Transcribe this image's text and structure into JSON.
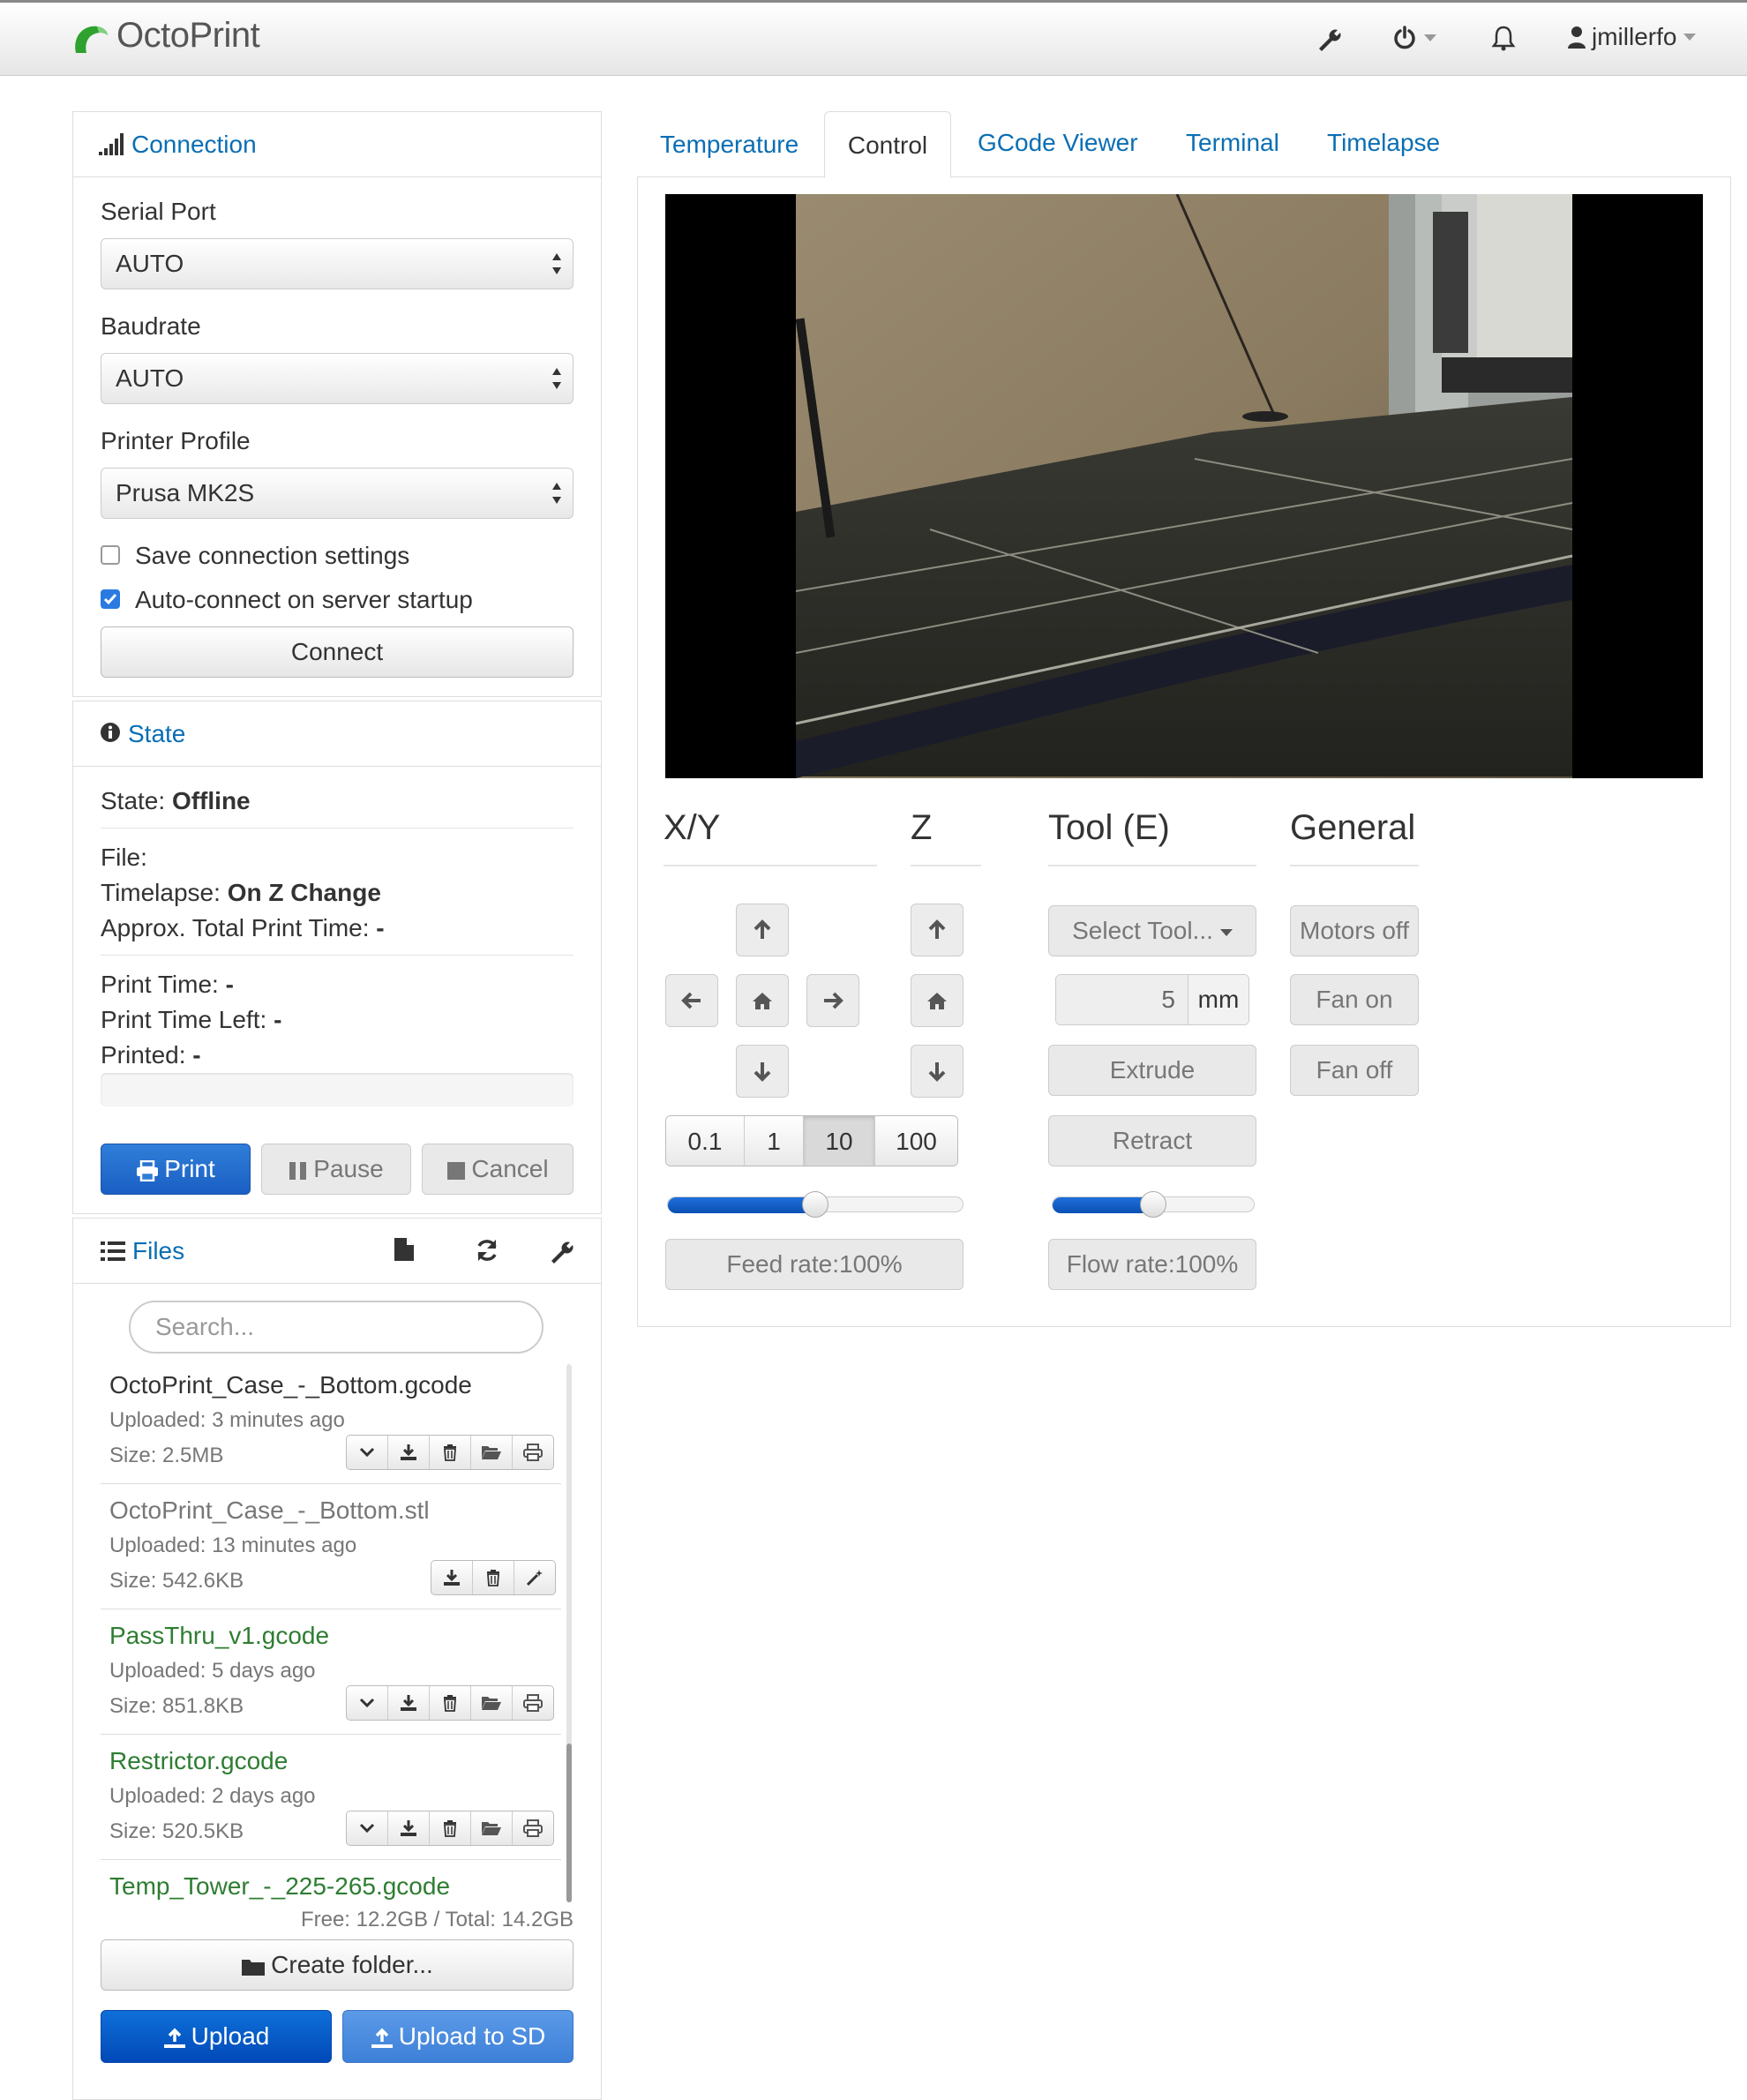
{
  "app": {
    "brand": "OctoPrint",
    "username": "jmillerfo"
  },
  "connection": {
    "title": "Connection",
    "serial_port_label": "Serial Port",
    "serial_port_value": "AUTO",
    "baudrate_label": "Baudrate",
    "baudrate_value": "AUTO",
    "profile_label": "Printer Profile",
    "profile_value": "Prusa MK2S",
    "save_label": "Save connection settings",
    "save_checked": false,
    "autoconnect_label": "Auto-connect on server startup",
    "autoconnect_checked": true,
    "connect_button": "Connect"
  },
  "state": {
    "title": "State",
    "state_label": "State:",
    "state_value": "Offline",
    "file_label": "File:",
    "timelapse_label": "Timelapse:",
    "timelapse_value": "On Z Change",
    "approx_label": "Approx. Total Print Time:",
    "approx_value": "-",
    "print_time_label": "Print Time:",
    "print_time_value": "-",
    "time_left_label": "Print Time Left:",
    "time_left_value": "-",
    "printed_label": "Printed:",
    "printed_value": "-",
    "progress": 0,
    "print_button": "Print",
    "pause_button": "Pause",
    "cancel_button": "Cancel"
  },
  "files": {
    "title": "Files",
    "search_placeholder": "Search...",
    "items": [
      {
        "name": "OctoPrint_Case_-_Bottom.gcode",
        "uploaded": "Uploaded: 3 minutes ago",
        "size": "Size: 2.5MB",
        "color": "#333333"
      },
      {
        "name": "OctoPrint_Case_-_Bottom.stl",
        "uploaded": "Uploaded: 13 minutes ago",
        "size": "Size: 542.6KB",
        "color": "#777777"
      },
      {
        "name": "PassThru_v1.gcode",
        "uploaded": "Uploaded: 5 days ago",
        "size": "Size: 851.8KB",
        "color": "#2e7d32"
      },
      {
        "name": "Restrictor.gcode",
        "uploaded": "Uploaded: 2 days ago",
        "size": "Size: 520.5KB",
        "color": "#2e7d32"
      },
      {
        "name": "Temp_Tower_-_225-265.gcode",
        "color": "#2e7d32"
      }
    ],
    "storage": "Free: 12.2GB / Total: 14.2GB",
    "create_folder_button": "Create folder...",
    "upload_button": "Upload",
    "upload_sd_button": "Upload to SD"
  },
  "tabs": [
    {
      "label": "Temperature"
    },
    {
      "label": "Control"
    },
    {
      "label": "GCode Viewer"
    },
    {
      "label": "Terminal"
    },
    {
      "label": "Timelapse"
    }
  ],
  "control": {
    "xy_heading": "X/Y",
    "z_heading": "Z",
    "tool_heading": "Tool (E)",
    "general_heading": "General",
    "step_options": [
      "0.1",
      "1",
      "10",
      "100"
    ],
    "step_selected": "10",
    "feed_rate_label": "Feed rate:100%",
    "feed_rate_slider": 0.5,
    "select_tool_label": "Select Tool...",
    "extrude_amount": "5",
    "extrude_unit": "mm",
    "extrude_button": "Extrude",
    "retract_button": "Retract",
    "flow_rate_label": "Flow rate:100%",
    "flow_rate_slider": 0.5,
    "motors_off_button": "Motors off",
    "fan_on_button": "Fan on",
    "fan_off_button": "Fan off"
  }
}
